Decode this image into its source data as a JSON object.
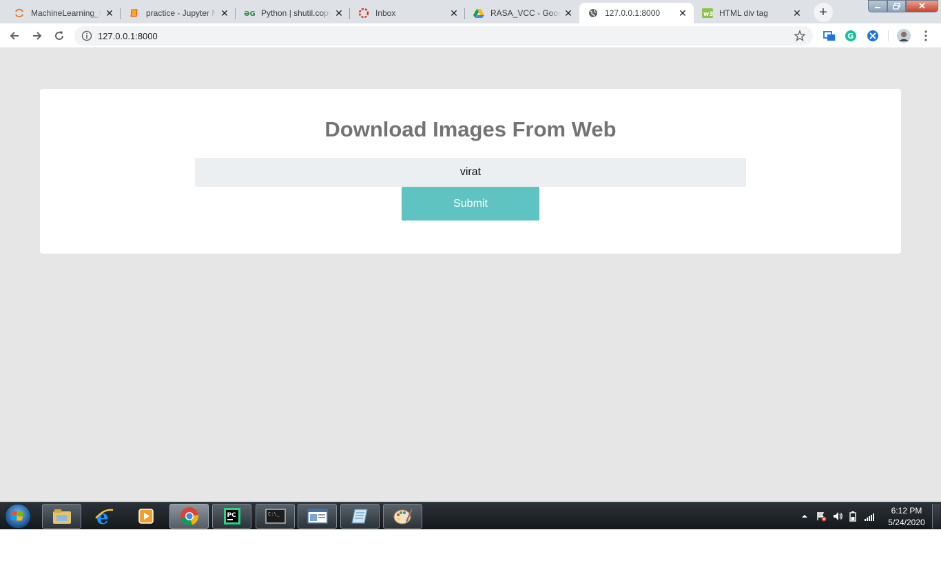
{
  "browser": {
    "tabs": [
      {
        "title": "MachineLearning_P",
        "icon": "jupyter-icon"
      },
      {
        "title": "practice - Jupyter N",
        "icon": "notebook-icon"
      },
      {
        "title": "Python | shutil.copy",
        "icon": "geeksforgeeks-icon"
      },
      {
        "title": "Inbox",
        "icon": "inbox-icon"
      },
      {
        "title": "RASA_VCC - Googl",
        "icon": "google-drive-icon"
      },
      {
        "title": "127.0.0.1:8000",
        "icon": "globe-icon",
        "active": true
      },
      {
        "title": "HTML div tag",
        "icon": "w3schools-icon"
      }
    ],
    "url": "127.0.0.1:8000"
  },
  "page": {
    "heading": "Download Images From Web",
    "query_value": "virat",
    "submit_label": "Submit"
  },
  "taskbar": {
    "items": [
      "windows-explorer-icon",
      "internet-explorer-icon",
      "media-player-icon",
      "chrome-icon",
      "pycharm-icon",
      "command-prompt-icon",
      "window-icon",
      "notepad-icon",
      "paint-icon"
    ],
    "time": "6:12 PM",
    "date": "5/24/2020"
  },
  "colors": {
    "page_background": "#e6e6e6",
    "heading": "#737373",
    "input_background": "#eceff1",
    "submit_button": "#5fc3c2"
  }
}
